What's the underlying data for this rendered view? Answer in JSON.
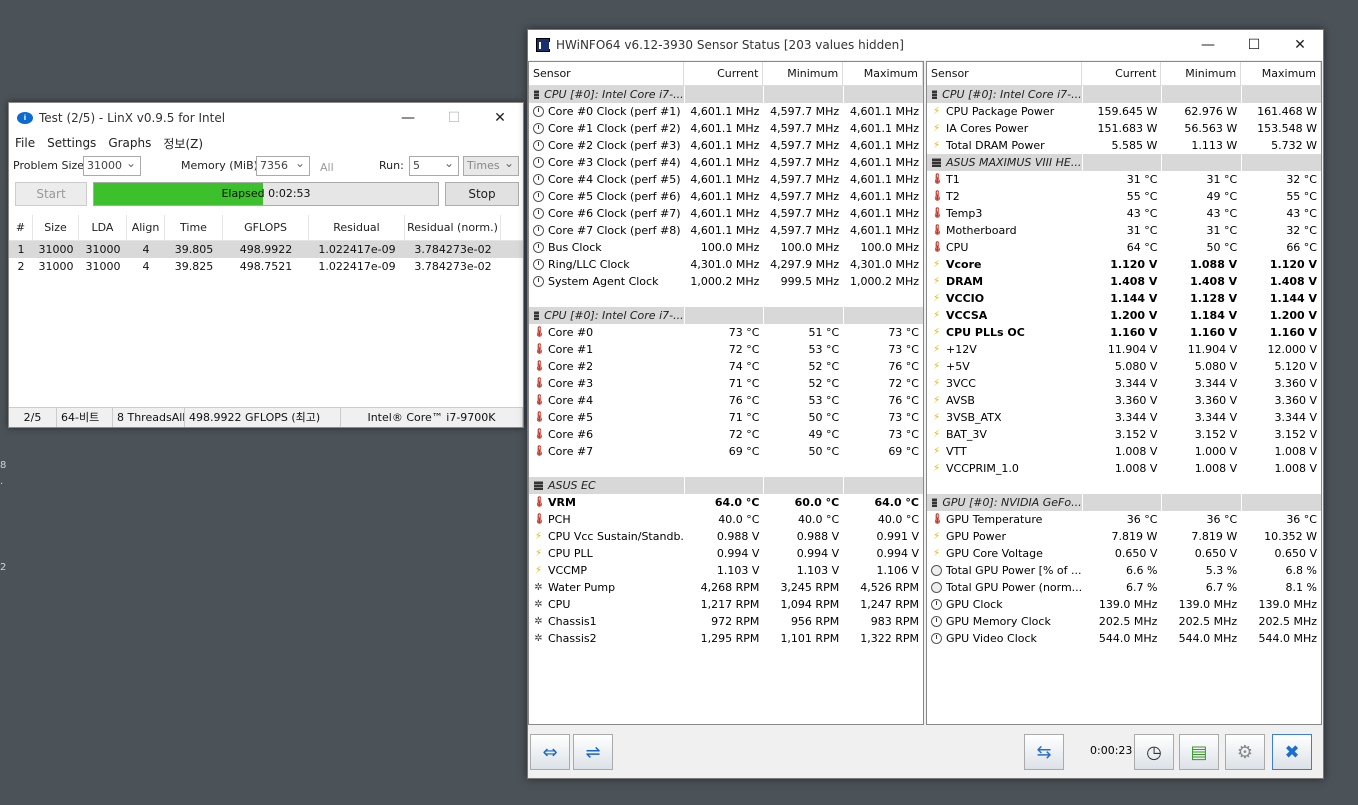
{
  "desktop": {
    "fragments": [
      "8",
      ".",
      "2"
    ]
  },
  "linx": {
    "title": "Test (2/5) - LinX v0.9.5 for Intel",
    "window_buttons": {
      "minimize": "—",
      "maximize": "☐",
      "close": "✕"
    },
    "menu": [
      "File",
      "Settings",
      "Graphs",
      "정보(Z)"
    ],
    "problem_size_label": "Problem Size:",
    "problem_size_value": "31000",
    "memory_label": "Memory (MiB):",
    "memory_value": "7356",
    "all_label": "All",
    "run_label": "Run:",
    "run_value": "5",
    "times_value": "Times",
    "start_label": "Start",
    "stop_label": "Stop",
    "elapsed_text": "Elapsed 0:02:53",
    "progress": 0.49,
    "columns": [
      "#",
      "Size",
      "LDA",
      "Align",
      "Time",
      "GFLOPS",
      "Residual",
      "Residual (norm.)"
    ],
    "rows": [
      [
        "1",
        "31000",
        "31000",
        "4",
        "39.805",
        "498.9922",
        "1.022417e-09",
        "3.784273e-02"
      ],
      [
        "2",
        "31000",
        "31000",
        "4",
        "39.825",
        "498.7521",
        "1.022417e-09",
        "3.784273e-02"
      ]
    ],
    "status": [
      "2/5",
      "64-비트",
      "8 ThreadsAll",
      "498.9922 GFLOPS (최고)",
      "Intel® Core™ i7-9700K"
    ]
  },
  "hw": {
    "title": "HWiNFO64 v6.12-3930 Sensor Status [203 values hidden]",
    "window_buttons": {
      "minimize": "—",
      "maximize": "☐",
      "close": "✕"
    },
    "columns": [
      "Sensor",
      "Current",
      "Minimum",
      "Maximum"
    ],
    "timer": "0:00:23",
    "left": [
      {
        "h": "CPU [#0]: Intel Core i7-..."
      },
      {
        "i": "clock",
        "n": "Core #0 Clock (perf #1)",
        "v": [
          "4,601.1 MHz",
          "4,597.7 MHz",
          "4,601.1 MHz"
        ]
      },
      {
        "i": "clock",
        "n": "Core #1 Clock (perf #2)",
        "v": [
          "4,601.1 MHz",
          "4,597.7 MHz",
          "4,601.1 MHz"
        ]
      },
      {
        "i": "clock",
        "n": "Core #2 Clock (perf #3)",
        "v": [
          "4,601.1 MHz",
          "4,597.7 MHz",
          "4,601.1 MHz"
        ]
      },
      {
        "i": "clock",
        "n": "Core #3 Clock (perf #4)",
        "v": [
          "4,601.1 MHz",
          "4,597.7 MHz",
          "4,601.1 MHz"
        ]
      },
      {
        "i": "clock",
        "n": "Core #4 Clock (perf #5)",
        "v": [
          "4,601.1 MHz",
          "4,597.7 MHz",
          "4,601.1 MHz"
        ]
      },
      {
        "i": "clock",
        "n": "Core #5 Clock (perf #6)",
        "v": [
          "4,601.1 MHz",
          "4,597.7 MHz",
          "4,601.1 MHz"
        ]
      },
      {
        "i": "clock",
        "n": "Core #6 Clock (perf #7)",
        "v": [
          "4,601.1 MHz",
          "4,597.7 MHz",
          "4,601.1 MHz"
        ]
      },
      {
        "i": "clock",
        "n": "Core #7 Clock (perf #8)",
        "v": [
          "4,601.1 MHz",
          "4,597.7 MHz",
          "4,601.1 MHz"
        ]
      },
      {
        "i": "clock",
        "n": "Bus Clock",
        "v": [
          "100.0 MHz",
          "100.0 MHz",
          "100.0 MHz"
        ]
      },
      {
        "i": "clock",
        "n": "Ring/LLC Clock",
        "v": [
          "4,301.0 MHz",
          "4,297.9 MHz",
          "4,301.0 MHz"
        ]
      },
      {
        "i": "clock",
        "n": "System Agent Clock",
        "v": [
          "1,000.2 MHz",
          "999.5 MHz",
          "1,000.2 MHz"
        ]
      },
      {
        "blank": true
      },
      {
        "h": "CPU [#0]: Intel Core i7-..."
      },
      {
        "i": "temp",
        "n": "Core #0",
        "v": [
          "73 °C",
          "51 °C",
          "73 °C"
        ]
      },
      {
        "i": "temp",
        "n": "Core #1",
        "v": [
          "72 °C",
          "53 °C",
          "73 °C"
        ]
      },
      {
        "i": "temp",
        "n": "Core #2",
        "v": [
          "74 °C",
          "52 °C",
          "76 °C"
        ]
      },
      {
        "i": "temp",
        "n": "Core #3",
        "v": [
          "71 °C",
          "52 °C",
          "72 °C"
        ]
      },
      {
        "i": "temp",
        "n": "Core #4",
        "v": [
          "76 °C",
          "53 °C",
          "76 °C"
        ]
      },
      {
        "i": "temp",
        "n": "Core #5",
        "v": [
          "71 °C",
          "50 °C",
          "73 °C"
        ]
      },
      {
        "i": "temp",
        "n": "Core #6",
        "v": [
          "72 °C",
          "49 °C",
          "73 °C"
        ]
      },
      {
        "i": "temp",
        "n": "Core #7",
        "v": [
          "69 °C",
          "50 °C",
          "69 °C"
        ]
      },
      {
        "blank": true
      },
      {
        "h": "ASUS EC"
      },
      {
        "i": "temp",
        "n": "VRM",
        "v": [
          "64.0 °C",
          "60.0 °C",
          "64.0 °C"
        ],
        "b": true
      },
      {
        "i": "temp",
        "n": "PCH",
        "v": [
          "40.0 °C",
          "40.0 °C",
          "40.0 °C"
        ]
      },
      {
        "i": "volt",
        "n": "CPU Vcc Sustain/Standb...",
        "v": [
          "0.988 V",
          "0.988 V",
          "0.991 V"
        ]
      },
      {
        "i": "volt",
        "n": "CPU PLL",
        "v": [
          "0.994 V",
          "0.994 V",
          "0.994 V"
        ]
      },
      {
        "i": "volt",
        "n": "VCCMP",
        "v": [
          "1.103 V",
          "1.103 V",
          "1.106 V"
        ]
      },
      {
        "i": "fan",
        "n": "Water Pump",
        "v": [
          "4,268 RPM",
          "3,245 RPM",
          "4,526 RPM"
        ]
      },
      {
        "i": "fan",
        "n": "CPU",
        "v": [
          "1,217 RPM",
          "1,094 RPM",
          "1,247 RPM"
        ]
      },
      {
        "i": "fan",
        "n": "Chassis1",
        "v": [
          "972 RPM",
          "956 RPM",
          "983 RPM"
        ]
      },
      {
        "i": "fan",
        "n": "Chassis2",
        "v": [
          "1,295 RPM",
          "1,101 RPM",
          "1,322 RPM"
        ]
      }
    ],
    "right": [
      {
        "h": "CPU [#0]: Intel Core i7-..."
      },
      {
        "i": "volt",
        "n": "CPU Package Power",
        "v": [
          "159.645 W",
          "62.976 W",
          "161.468 W"
        ]
      },
      {
        "i": "volt",
        "n": "IA Cores Power",
        "v": [
          "151.683 W",
          "56.563 W",
          "153.548 W"
        ]
      },
      {
        "i": "volt",
        "n": "Total DRAM Power",
        "v": [
          "5.585 W",
          "1.113 W",
          "5.732 W"
        ]
      },
      {
        "h": "ASUS MAXIMUS VIII HE..."
      },
      {
        "i": "temp",
        "n": "T1",
        "v": [
          "31 °C",
          "31 °C",
          "32 °C"
        ]
      },
      {
        "i": "temp",
        "n": "T2",
        "v": [
          "55 °C",
          "49 °C",
          "55 °C"
        ]
      },
      {
        "i": "temp",
        "n": "Temp3",
        "v": [
          "43 °C",
          "43 °C",
          "43 °C"
        ]
      },
      {
        "i": "temp",
        "n": "Motherboard",
        "v": [
          "31 °C",
          "31 °C",
          "32 °C"
        ]
      },
      {
        "i": "temp",
        "n": "CPU",
        "v": [
          "64 °C",
          "50 °C",
          "66 °C"
        ]
      },
      {
        "i": "volt",
        "n": "Vcore",
        "v": [
          "1.120 V",
          "1.088 V",
          "1.120 V"
        ],
        "b": true
      },
      {
        "i": "volt",
        "n": "DRAM",
        "v": [
          "1.408 V",
          "1.408 V",
          "1.408 V"
        ],
        "b": true
      },
      {
        "i": "volt",
        "n": "VCCIO",
        "v": [
          "1.144 V",
          "1.128 V",
          "1.144 V"
        ],
        "b": true
      },
      {
        "i": "volt",
        "n": "VCCSA",
        "v": [
          "1.200 V",
          "1.184 V",
          "1.200 V"
        ],
        "b": true
      },
      {
        "i": "volt",
        "n": "CPU PLLs OC",
        "v": [
          "1.160 V",
          "1.160 V",
          "1.160 V"
        ],
        "b": true
      },
      {
        "i": "volt",
        "n": "+12V",
        "v": [
          "11.904 V",
          "11.904 V",
          "12.000 V"
        ]
      },
      {
        "i": "volt",
        "n": "+5V",
        "v": [
          "5.080 V",
          "5.080 V",
          "5.120 V"
        ]
      },
      {
        "i": "volt",
        "n": "3VCC",
        "v": [
          "3.344 V",
          "3.344 V",
          "3.360 V"
        ]
      },
      {
        "i": "volt",
        "n": "AVSB",
        "v": [
          "3.360 V",
          "3.360 V",
          "3.360 V"
        ]
      },
      {
        "i": "volt",
        "n": "3VSB_ATX",
        "v": [
          "3.344 V",
          "3.344 V",
          "3.344 V"
        ]
      },
      {
        "i": "volt",
        "n": "BAT_3V",
        "v": [
          "3.152 V",
          "3.152 V",
          "3.152 V"
        ]
      },
      {
        "i": "volt",
        "n": "VTT",
        "v": [
          "1.008 V",
          "1.000 V",
          "1.008 V"
        ]
      },
      {
        "i": "volt",
        "n": "VCCPRIM_1.0",
        "v": [
          "1.008 V",
          "1.008 V",
          "1.008 V"
        ]
      },
      {
        "blank": true
      },
      {
        "h": "GPU [#0]: NVIDIA GeFo..."
      },
      {
        "i": "temp",
        "n": "GPU Temperature",
        "v": [
          "36 °C",
          "36 °C",
          "36 °C"
        ]
      },
      {
        "i": "volt",
        "n": "GPU Power",
        "v": [
          "7.819 W",
          "7.819 W",
          "10.352 W"
        ]
      },
      {
        "i": "volt",
        "n": "GPU Core Voltage",
        "v": [
          "0.650 V",
          "0.650 V",
          "0.650 V"
        ]
      },
      {
        "i": "pct",
        "n": "Total GPU Power [% of ...",
        "v": [
          "6.6 %",
          "5.3 %",
          "6.8 %"
        ]
      },
      {
        "i": "pct",
        "n": "Total GPU Power (norm...",
        "v": [
          "6.7 %",
          "6.7 %",
          "8.1 %"
        ]
      },
      {
        "i": "clock",
        "n": "GPU Clock",
        "v": [
          "139.0 MHz",
          "139.0 MHz",
          "139.0 MHz"
        ]
      },
      {
        "i": "clock",
        "n": "GPU Memory Clock",
        "v": [
          "202.5 MHz",
          "202.5 MHz",
          "202.5 MHz"
        ]
      },
      {
        "i": "clock",
        "n": "GPU Video Clock",
        "v": [
          "544.0 MHz",
          "544.0 MHz",
          "544.0 MHz"
        ]
      }
    ]
  }
}
